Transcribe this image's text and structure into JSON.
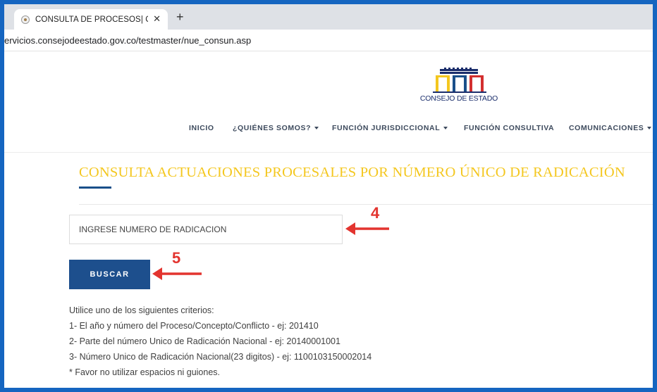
{
  "browser": {
    "tab_title": "CONSULTA DE PROCESOS| Co",
    "url": "ervicios.consejodeestado.gov.co/testmaster/nue_consun.asp"
  },
  "header": {
    "logo_text": "CONSEJO DE ESTADO",
    "nav": [
      {
        "label": "INICIO"
      },
      {
        "label": "¿QUIÉNES SOMOS?"
      },
      {
        "label": "FUNCIÓN JURISDICCIONAL"
      },
      {
        "label": "FUNCIÓN CONSULTIVA"
      },
      {
        "label": "COMUNICACIONES"
      }
    ]
  },
  "main": {
    "heading": "CONSULTA ACTUACIONES PROCESALES POR NÚMERO ÚNICO DE RADICACIÓN",
    "search_placeholder": "INGRESE NUMERO DE RADICACION",
    "search_button": "BUSCAR",
    "criteria": [
      "Utilice uno de los siguientes criterios:",
      "1- El año y número del Proceso/Concepto/Conflicto - ej: 201410",
      "2- Parte del número Unico de Radicación Nacional - ej: 20140001001",
      "3- Número Unico de Radicación Nacional(23 digitos) - ej: 1100103150002014",
      "* Favor no utilizar espacios ni guiones."
    ]
  },
  "annotations": {
    "step_4": "4",
    "step_5": "5"
  },
  "colors": {
    "border": "#1565c0",
    "heading": "#f4c71f",
    "button": "#1d4f8d",
    "arrow": "#e3342f"
  }
}
